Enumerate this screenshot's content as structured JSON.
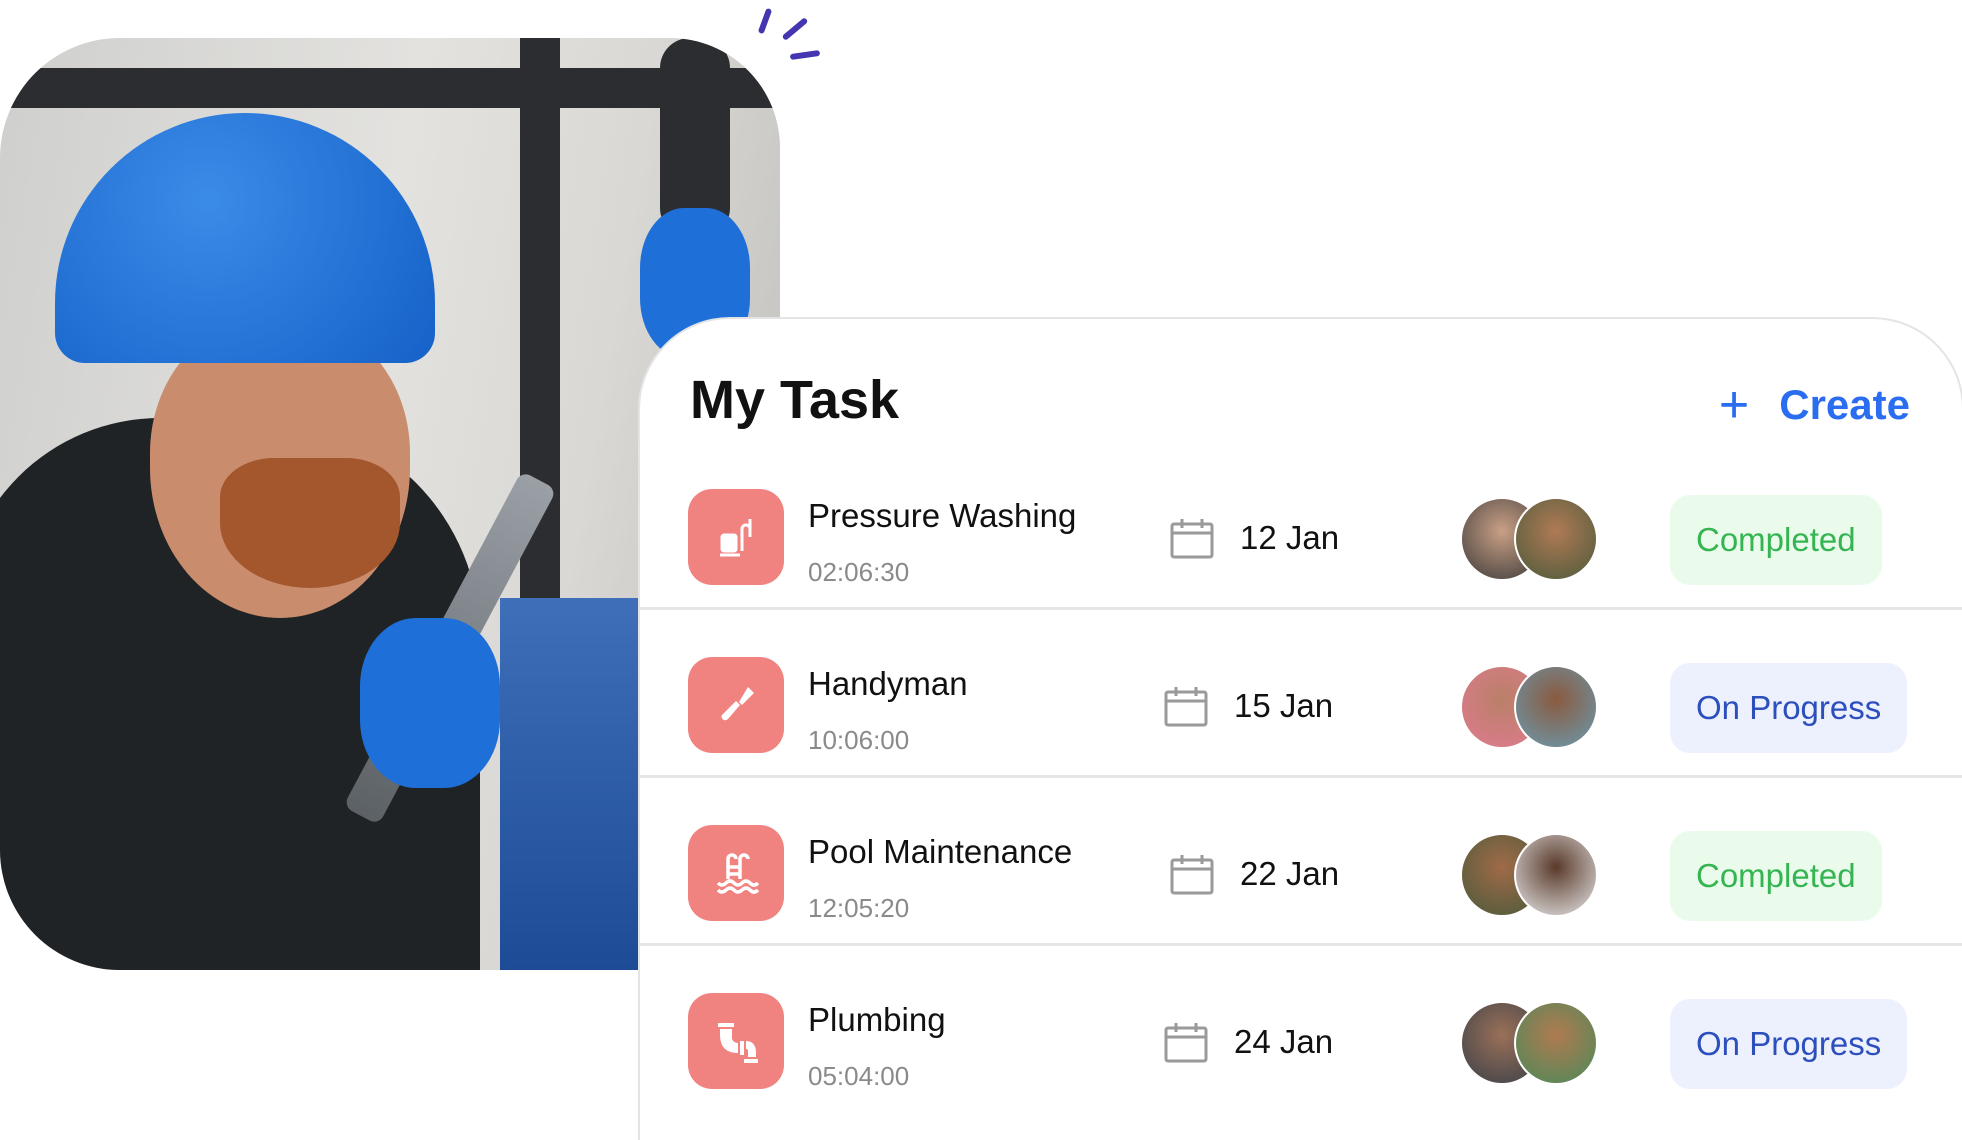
{
  "card": {
    "title": "My Task",
    "create_label": "Create",
    "create_icon": "plus-icon"
  },
  "tasks": [
    {
      "name": "Pressure Washing",
      "time": "02:06:30",
      "date": "12 Jan",
      "status": "Completed",
      "icon": "pressure-washer-icon"
    },
    {
      "name": "Handyman",
      "time": "10:06:00",
      "date": "15 Jan",
      "status": "On Progress",
      "icon": "screwdriver-icon"
    },
    {
      "name": "Pool Maintenance",
      "time": "12:05:20",
      "date": "22 Jan",
      "status": "Completed",
      "icon": "pool-ladder-icon"
    },
    {
      "name": "Plumbing",
      "time": "05:04:00",
      "date": "24 Jan",
      "status": "On Progress",
      "icon": "pipe-icon"
    }
  ],
  "colors": {
    "accent": "#2a6df0",
    "task_icon_bg": "#f08280",
    "completed_bg": "#eafbec",
    "completed_text": "#35b552",
    "progress_bg": "#edf1fd",
    "progress_text": "#2d4fbe",
    "decoration": "#4436b0"
  }
}
